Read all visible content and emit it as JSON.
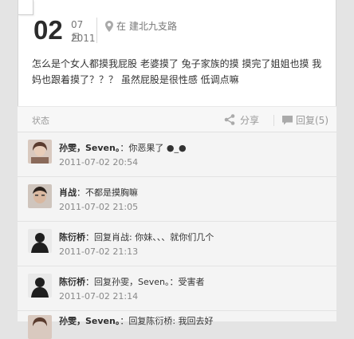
{
  "post": {
    "day": "02",
    "month": "07月",
    "year": "2011",
    "location": "在 建北九支路",
    "content": "怎么是个女人都摸我屁股 老婆摸了 兔子家族的摸 摸完了姐姐也摸 我妈也跟着摸了？？？  虽然屁股是很性感 低调点嘛"
  },
  "actions": {
    "status": "状态",
    "share": "分享",
    "reply": "回复(5)"
  },
  "comments": [
    {
      "name": "孙雯，Seven。",
      "sep": "：",
      "text": "你恶果了 ●_●",
      "time": "2011-07-02 20:54",
      "avatar_color": "#6b4a3a"
    },
    {
      "name": "肖战",
      "sep": "：",
      "text": "不都是摸胸嘛",
      "time": "2011-07-02 21:05",
      "avatar_color": "#3a2c25"
    },
    {
      "name": "陈衍桥",
      "sep": "：",
      "text": "回复肖战: 你妹、、、就你们几个",
      "time": "2011-07-02 21:13",
      "avatar_color": "#2a2a2a"
    },
    {
      "name": "陈衍桥",
      "sep": "：",
      "text": "回复孙雯，Seven。：受害者",
      "time": "2011-07-02 21:14",
      "avatar_color": "#2a2a2a"
    },
    {
      "name": "孙雯，Seven。",
      "sep": "：",
      "text": "回复陈衍桥: 我回去好 ",
      "time": "",
      "avatar_color": "#6b4a3a"
    }
  ]
}
